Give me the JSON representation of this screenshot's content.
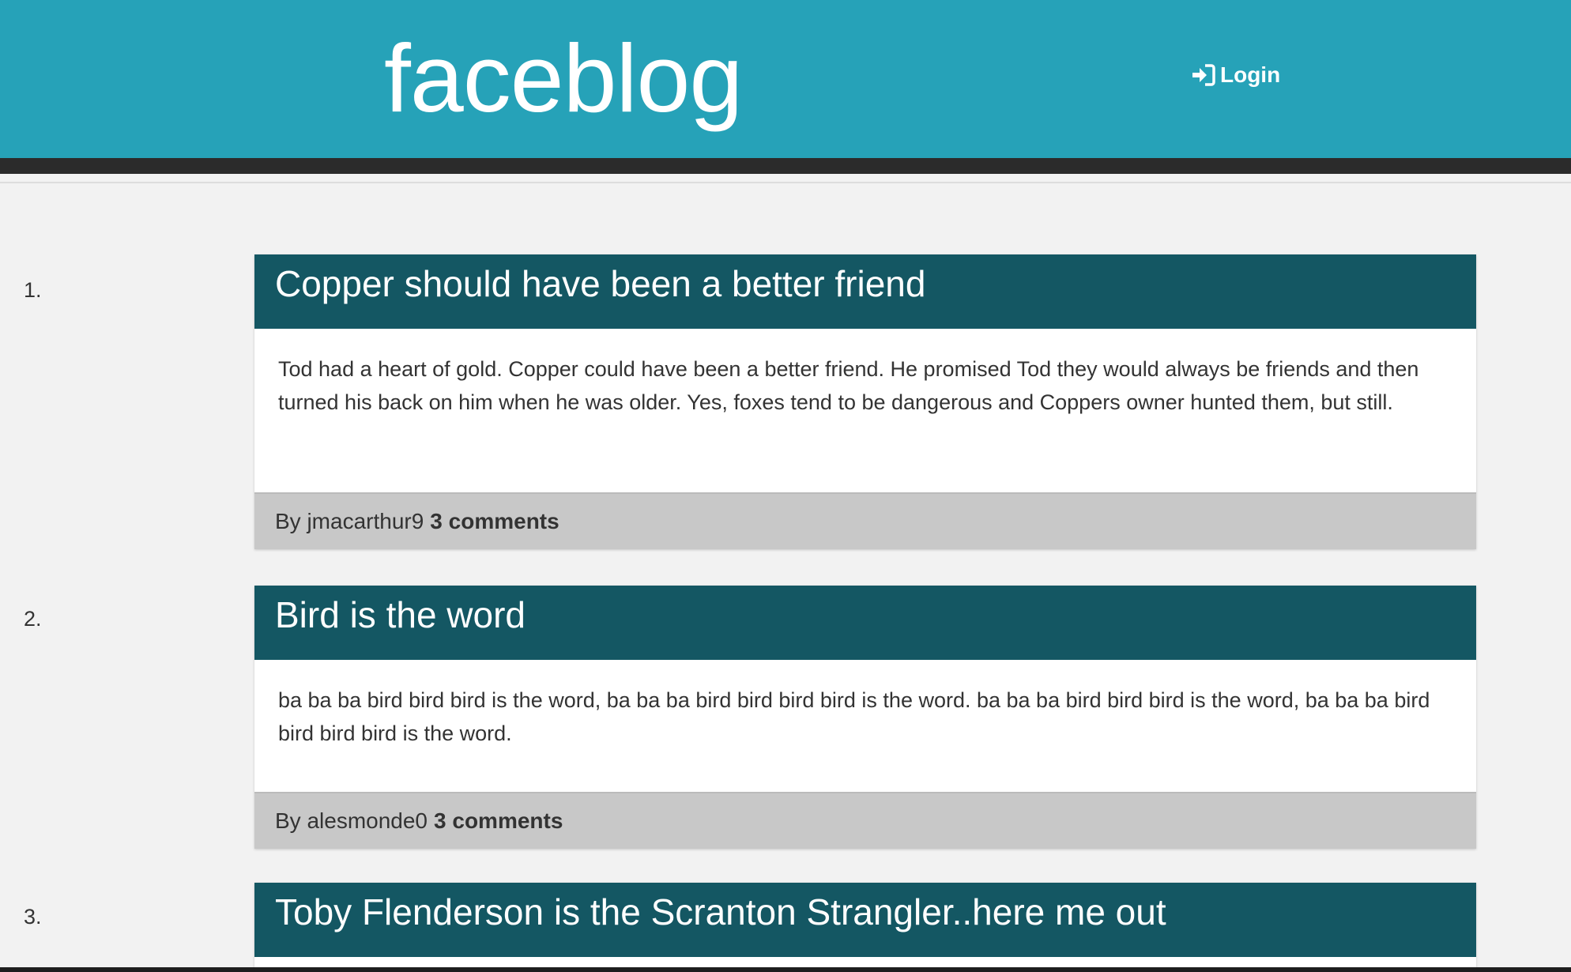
{
  "header": {
    "brand": "faceblog",
    "login_label": "Login"
  },
  "posts": [
    {
      "number": "1.",
      "title": "Copper should have been a better friend",
      "body": "Tod had a heart of gold. Copper could have been a better friend. He promised Tod they would always be friends and then turned his back on him when he was older. Yes, foxes tend to be dangerous and Coppers owner hunted them, but still.",
      "author": "By jmacarthur9",
      "comments": "3 comments"
    },
    {
      "number": "2.",
      "title": "Bird is the word",
      "body": "ba ba ba bird bird bird is the word, ba ba ba bird bird bird bird is the word. ba ba ba bird bird bird is the word, ba ba ba bird bird bird bird is the word.",
      "author": "By alesmonde0",
      "comments": "3 comments"
    },
    {
      "number": "3.",
      "title": "Toby Flenderson is the Scranton Strangler..here me out"
    }
  ]
}
